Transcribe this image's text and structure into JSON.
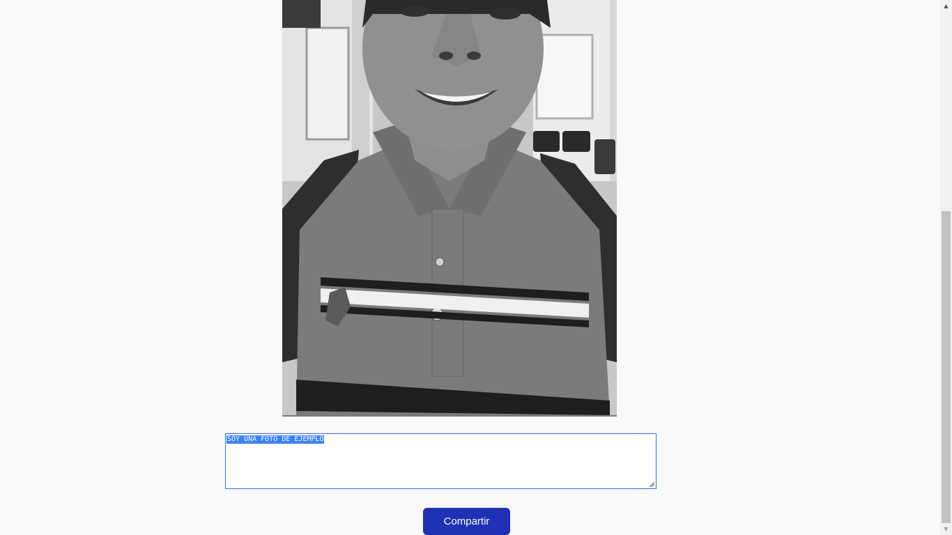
{
  "photo": {
    "alt": "Selfie of a smiling young man in a striped polo shirt wearing a backpack, grayscale"
  },
  "caption": {
    "value": "SOY UNA FOTO DE EJEMPLO"
  },
  "share": {
    "label": "Compartir"
  },
  "colors": {
    "button": "#1f31b4",
    "focus_border": "#2e6be6",
    "selection": "#3b82f6",
    "background": "#f9f9f9"
  },
  "scrollbar": {
    "up_icon": "▲",
    "down_icon": "▼"
  }
}
